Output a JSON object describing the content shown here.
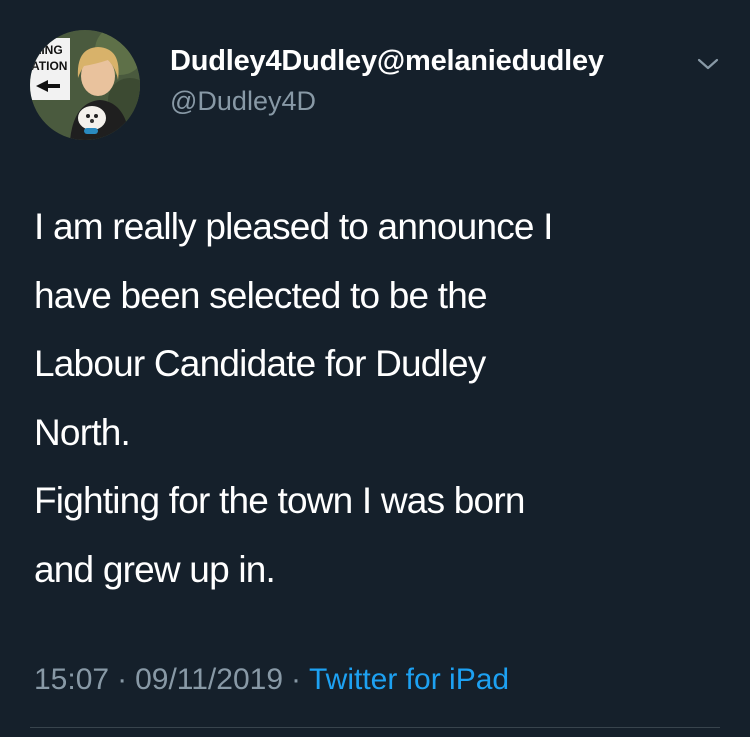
{
  "user": {
    "display_name": "Dudley4Dudley@melaniedudley",
    "handle": "@Dudley4D",
    "avatar_sign_text": [
      "LING",
      "ATION"
    ]
  },
  "tweet": {
    "lines": [
      "I am really pleased to announce I",
      "have been selected to be the",
      "Labour Candidate for Dudley",
      "North.",
      "Fighting for the town I was born",
      "and grew up in."
    ],
    "time": "15:07",
    "date": "09/11/2019",
    "separator": "·",
    "source": "Twitter for iPad"
  },
  "colors": {
    "background": "#15202b",
    "text": "#ffffff",
    "secondary": "#8899a6",
    "link": "#1da1f2",
    "divider": "#38444d"
  },
  "icons": {
    "menu": "chevron-down-icon"
  }
}
